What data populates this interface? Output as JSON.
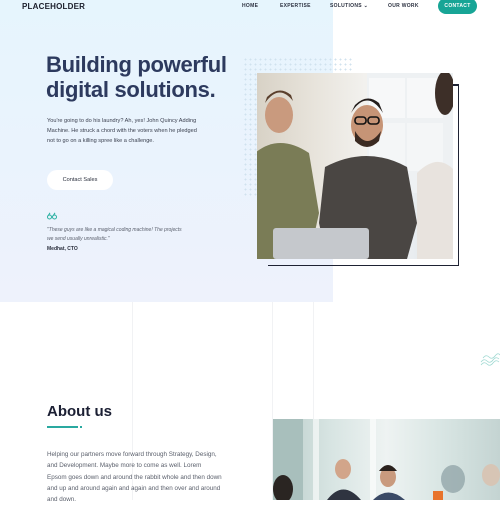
{
  "header": {
    "logo": "PLACEHOLDER",
    "nav": [
      {
        "label": "HOME"
      },
      {
        "label": "EXPERTISE"
      },
      {
        "label": "SOLUTIONS",
        "icon": "chevron-down-icon"
      },
      {
        "label": "OUR WORK"
      }
    ],
    "contact_label": "CONTACT"
  },
  "hero": {
    "title_line1": "Building powerful",
    "title_line2": "digital solutions.",
    "text": "You're going to do his laundry? Ah, yes! John Quincy Adding Machine. He struck a chord with the voters when he pledged not to go on a killing spree like a challenge.",
    "cta_label": "Contact Sales",
    "quote_icon": "“",
    "quote": "\"These guys are like a magical coding machine! The projects we send usually unrealistic.\"",
    "quote_author": "Medhat, CTO"
  },
  "about": {
    "title": "About us",
    "text": "Helping our partners move forward through Strategy, Design, and Development. Maybe more to come as well. Lorem Epsom goes down and around the rabbit whole and then down and up and around again and again and then over and around and down."
  },
  "colors": {
    "accent": "#17a596",
    "heading": "#2d3a5e",
    "hero_bg": "#e6f5fd"
  }
}
